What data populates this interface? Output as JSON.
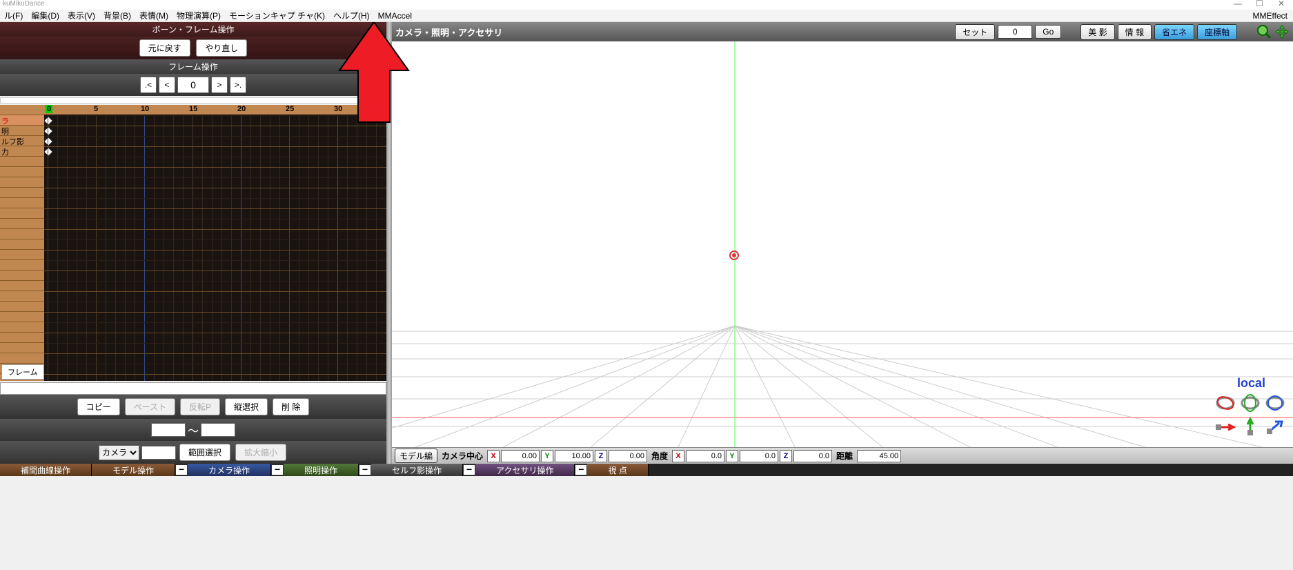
{
  "title": "kuMikuDance",
  "menu": {
    "file": "ル(F)",
    "edit": "編集(D)",
    "view": "表示(V)",
    "bg": "背景(B)",
    "exp": "表情(M)",
    "physics": "物理演算(P)",
    "mocap": "モーションキャプ チャ(K)",
    "help": "ヘルプ(H)",
    "mmaccel": "MMAccel",
    "mmeffect": "MMEffect"
  },
  "bone": {
    "header": "ボーン・フレーム操作",
    "undo": "元に戻す",
    "redo": "やり直し"
  },
  "frame": {
    "header": "フレーム操作",
    "first": ".<",
    "prev": "<",
    "value": "0",
    "next": ">",
    "last": ">."
  },
  "tracks": {
    "items": [
      "ラ",
      "明",
      "ルフ影",
      "力"
    ]
  },
  "ruler": {
    "marks": [
      "0",
      "5",
      "10",
      "15",
      "20",
      "25",
      "30"
    ]
  },
  "frame_label": "フレーム",
  "edit": {
    "copy": "コピー",
    "paste": "ペースト",
    "reverse": "反転P",
    "vselect": "縦選択",
    "delete": "削 除",
    "tilde": "～",
    "range": "範囲選択",
    "scale": "拡大縮小",
    "combo": "カメラ"
  },
  "view": {
    "title": "カメラ・照明・アクセサリ",
    "set": "セット",
    "setval": "0",
    "go": "Go",
    "shadow": "美 影",
    "info": "情 報",
    "eco": "省エネ",
    "axes": "座標軸",
    "local": "local"
  },
  "coord": {
    "model_edit": "モデル編",
    "center": "カメラ中心",
    "cx": "0.00",
    "cy": "10.00",
    "cz": "0.00",
    "angle": "角度",
    "ax": "0.0",
    "ay": "0.0",
    "az": "0.0",
    "dist": "距離",
    "dval": "45.00"
  },
  "tabs": {
    "interp": "補間曲線操作",
    "model": "モデル操作",
    "camera": "カメラ操作",
    "light": "照明操作",
    "selfshadow": "セルフ影操作",
    "accessory": "アクセサリ操作",
    "view": "視 点"
  }
}
